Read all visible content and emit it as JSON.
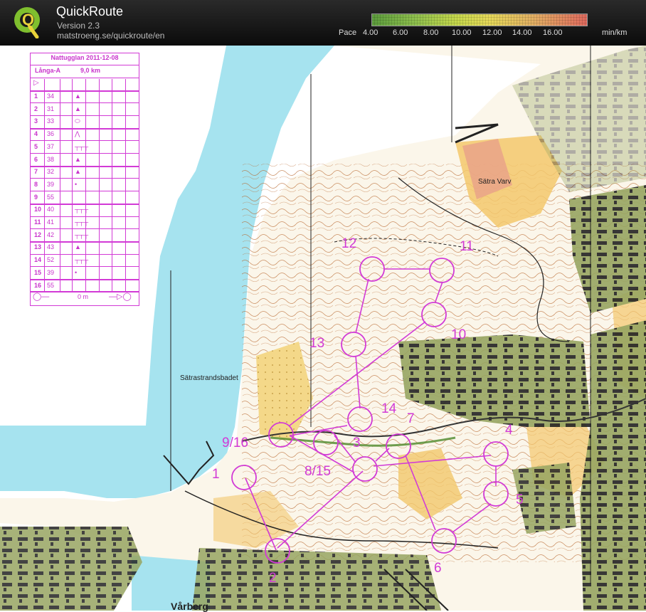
{
  "header": {
    "app_title": "QuickRoute",
    "version": "Version 2.3",
    "url": "matstroeng.se/quickroute/en",
    "pace_label": "Pace",
    "pace_ticks": [
      "4.00",
      "6.00",
      "8.00",
      "10.00",
      "12.00",
      "14.00",
      "16.00"
    ],
    "pace_unit": "min/km"
  },
  "control_sheet": {
    "title": "Nattugglan 2011-12-08",
    "course": "Långa-A",
    "length": "9,0 km",
    "start_symbol": "▷",
    "rows": [
      {
        "num": "1",
        "code": "34",
        "symbol": "▲"
      },
      {
        "num": "2",
        "code": "31",
        "symbol": "▲"
      },
      {
        "num": "3",
        "code": "33",
        "symbol": "⬭"
      },
      {
        "num": "4",
        "code": "36",
        "symbol": "⋀"
      },
      {
        "num": "5",
        "code": "37",
        "symbol": "┬┬┬"
      },
      {
        "num": "6",
        "code": "38",
        "symbol": "▲"
      },
      {
        "num": "7",
        "code": "32",
        "symbol": "▲"
      },
      {
        "num": "8",
        "code": "39",
        "symbol": "•"
      },
      {
        "num": "9",
        "code": "55",
        "symbol": ""
      },
      {
        "num": "10",
        "code": "40",
        "symbol": "┬┬┬"
      },
      {
        "num": "11",
        "code": "41",
        "symbol": "┬┬┬"
      },
      {
        "num": "12",
        "code": "42",
        "symbol": "┬┬┬"
      },
      {
        "num": "13",
        "code": "43",
        "symbol": "▲"
      },
      {
        "num": "14",
        "code": "52",
        "symbol": "┬┬┬"
      },
      {
        "num": "15",
        "code": "39",
        "symbol": "•"
      },
      {
        "num": "16",
        "code": "55",
        "symbol": ""
      }
    ],
    "finish_left": "◯—",
    "finish_distance": "0 m",
    "finish_right": "—▷◯"
  },
  "map": {
    "place_labels": [
      "Sätra Varv",
      "Sätrastrandsbadet",
      "Vårberg"
    ],
    "control_labels": [
      "1",
      "2",
      "3",
      "4",
      "5",
      "6",
      "7",
      "8/15",
      "9/16",
      "10",
      "11",
      "12",
      "13",
      "14"
    ]
  },
  "colors": {
    "course_magenta": "#d23ad6",
    "water": "#a6e3ef",
    "open_land": "#f3cf7d",
    "forest": "#fbfaf3",
    "urban": "#8f9a5e",
    "contour": "#b7642a"
  }
}
